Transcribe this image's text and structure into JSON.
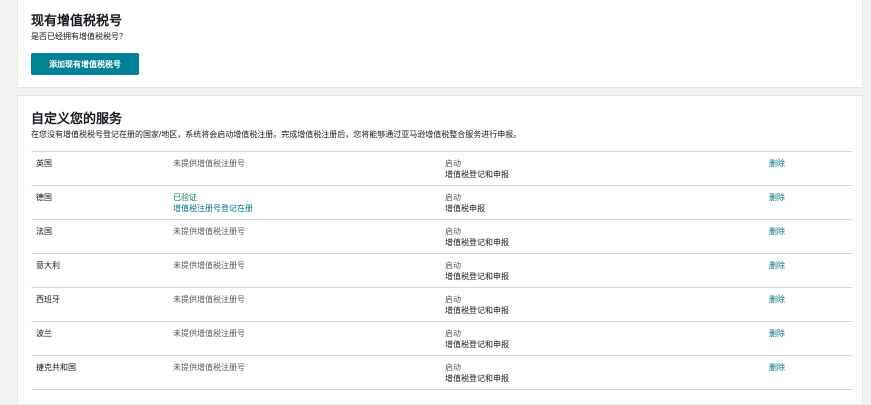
{
  "existing_vat": {
    "title": "现有增值税税号",
    "question": "是否已经拥有增值税税号？",
    "add_button": "添加现有增值税税号"
  },
  "custom_services": {
    "title": "自定义您的服务",
    "description": "在您没有增值税税号登记在册的国家/地区，系统将会启动增值税注册。完成增值税注册后，您将能够通过亚马逊增值税整合服务进行申报。",
    "rows": [
      {
        "country": "英国",
        "vat_status": "未提供增值税注册号",
        "vat_status_2": "",
        "status": "启动",
        "service": "增值税登记和申报",
        "action": "删除"
      },
      {
        "country": "德国",
        "vat_status": "已验证",
        "vat_status_2": "增值税注册号登记在册",
        "status": "启动",
        "service": "增值税申报",
        "action": "删除"
      },
      {
        "country": "法国",
        "vat_status": "未提供增值税注册号",
        "vat_status_2": "",
        "status": "启动",
        "service": "增值税登记和申报",
        "action": "删除"
      },
      {
        "country": "意大利",
        "vat_status": "未提供增值税注册号",
        "vat_status_2": "",
        "status": "启动",
        "service": "增值税登记和申报",
        "action": "删除"
      },
      {
        "country": "西班牙",
        "vat_status": "未提供增值税注册号",
        "vat_status_2": "",
        "status": "启动",
        "service": "增值税登记和申报",
        "action": "删除"
      },
      {
        "country": "波兰",
        "vat_status": "未提供增值税注册号",
        "vat_status_2": "",
        "status": "启动",
        "service": "增值税登记和申报",
        "action": "删除"
      },
      {
        "country": "捷克共和国",
        "vat_status": "未提供增值税注册号",
        "vat_status_2": "",
        "status": "启动",
        "service": "增值税登记和申报",
        "action": "删除"
      }
    ]
  },
  "colors": {
    "accent": "#008296",
    "link": "#007185",
    "verified": "#067d62",
    "background": "#f2f3f3"
  }
}
